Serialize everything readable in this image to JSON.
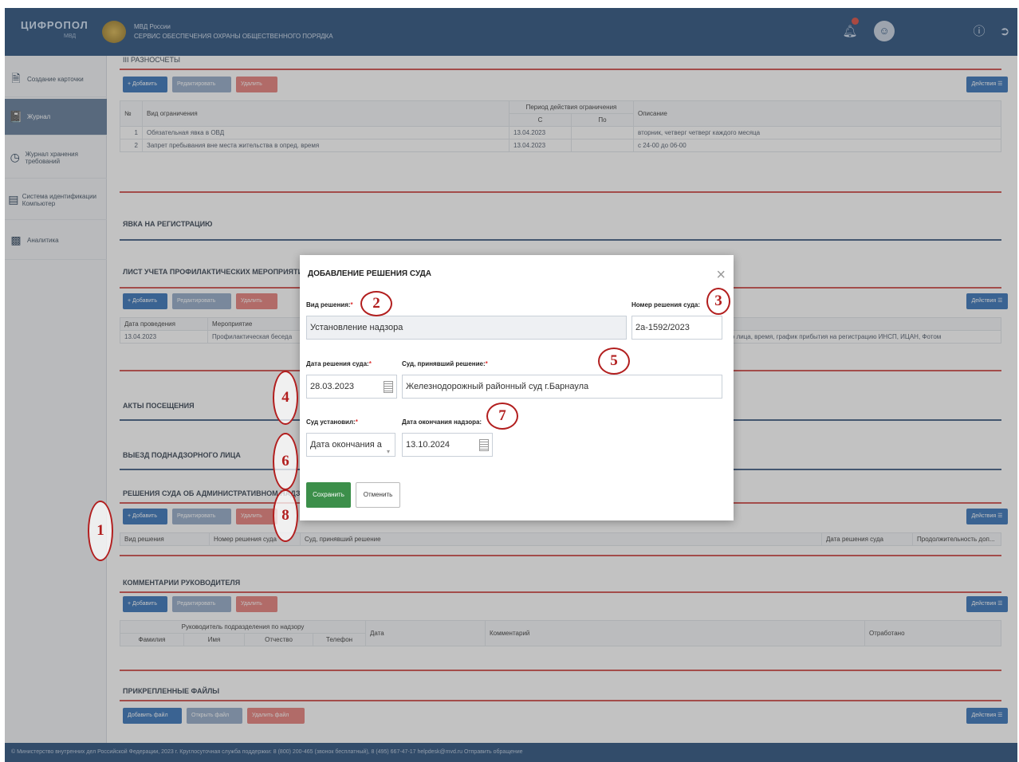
{
  "header": {
    "logo": "ЦИФРОПОЛ",
    "logo_sub": "МВД",
    "ministry_line1": "МВД России",
    "ministry_line2": "СЕРВИС ОБЕСПЕЧЕНИЯ ОХРАНЫ ОБЩЕСТВЕННОГО ПОРЯДКА",
    "icons": [
      "bell-icon",
      "user-avatar-icon",
      "help-icon",
      "logout-icon"
    ]
  },
  "sidebar": {
    "items": [
      {
        "label": "Создание карточки",
        "icon": "document-icon"
      },
      {
        "label": "Журнал",
        "icon": "journal-icon"
      },
      {
        "label": "Журнал хранения требований",
        "icon": "clock-icon"
      },
      {
        "label": "Система идентификации Компьютер",
        "icon": "id-card-icon"
      },
      {
        "label": "Аналитика",
        "icon": "chart-icon"
      }
    ],
    "collapse": "—"
  },
  "sections": {
    "restrictions": {
      "title": "III РАЗНОСЧЕТЫ",
      "buttons": {
        "add": "+ Добавить",
        "edit": "Редактировать",
        "delete": "Удалить",
        "actions": "Действия ☰"
      },
      "columns": {
        "num": "№",
        "type": "Вид ограничения",
        "period": "Период действия ограничения",
        "from": "С",
        "to": "По",
        "desc": "Описание"
      },
      "rows": [
        {
          "num": "1",
          "type": "Обязательная явка в ОВД",
          "from": "13.04.2023",
          "to": "",
          "desc": "вторник, четверг четверг каждого месяца"
        },
        {
          "num": "2",
          "type": "Запрет пребывания вне места жительства в опред. время",
          "from": "13.04.2023",
          "to": "",
          "desc": "с 24-00 до 06-00"
        }
      ]
    },
    "registration": {
      "title": "ЯВКА НА РЕГИСТРАЦИЮ"
    },
    "prevention": {
      "title": "ЛИСТ УЧЕТА ПРОФИЛАКТИЧЕСКИХ МЕРОПРИЯТИЙ",
      "columns": {
        "date": "Дата проведения",
        "event": "Мероприятие"
      },
      "row": {
        "date": "13.04.2023",
        "event": "Профилактическая беседа",
        "extra": "поднадзорного лица, время, график прибытия на регистрацию ИНСП, ИЦАН, Фотом"
      }
    },
    "visits": {
      "title": "АКТЫ ПОСЕЩЕНИЯ"
    },
    "departure": {
      "title": "ВЫЕЗД ПОДНАДЗОРНОГО ЛИЦА"
    },
    "court": {
      "title": "РЕШЕНИЯ СУДА ОБ АДМИНИСТРАТИВНОМ НАДЗОРЕ",
      "columns": {
        "type": "Вид решения",
        "number": "Номер решения суда",
        "court": "Суд, принявший решение",
        "date": "Дата решения суда",
        "extension": "Продолжительность доп..."
      }
    },
    "comments": {
      "title": "КОММЕНТАРИИ РУКОВОДИТЕЛЯ",
      "columns": {
        "head": "Руководитель подразделения по надзору",
        "last": "Фамилия",
        "first": "Имя",
        "patronymic": "Отчество",
        "phone": "Телефон",
        "date": "Дата",
        "comment": "Комментарий",
        "sent": "Отработано"
      }
    },
    "files": {
      "title": "ПРИКРЕПЛЕННЫЕ ФАЙЛЫ",
      "buttons": {
        "add": "Добавить файл",
        "open": "Открыть файл",
        "delete": "Удалить файл"
      }
    }
  },
  "modal": {
    "title": "ДОБАВЛЕНИЕ РЕШЕНИЯ СУДА",
    "decision_type_label": "Вид решения:",
    "decision_type_value": "Установление надзора",
    "decision_number_label": "Номер решения суда:",
    "decision_number_value": "2а-1592/2023",
    "decision_date_label": "Дата решения суда:",
    "decision_date_value": "28.03.2023",
    "court_label": "Суд, принявший решение:",
    "court_value": "Железнодорожный районный суд г.Барнаула",
    "court_set_label": "Суд установил:",
    "court_set_value": "Дата окончания а",
    "end_date_label": "Дата окончания надзора:",
    "end_date_value": "13.10.2024",
    "save": "Сохранить",
    "cancel": "Отменить",
    "required_mark": "*"
  },
  "markers": [
    "1",
    "2",
    "3",
    "4",
    "5",
    "6",
    "7",
    "8"
  ],
  "footer": {
    "text": "© Министерство внутренних дел Российской Федерации, 2023 г.   Круглосуточная служба поддержки:  8 (800) 200-465 (звонок бесплатный), 8 (495) 667-47-17   helpdesk@mvd.ru   Отправить обращение"
  },
  "colors": {
    "header": "#234b79",
    "accent_red": "#cf4b48",
    "primary": "#2f6db5",
    "save_green": "#3c8f4a",
    "marker": "#b21e1e"
  }
}
